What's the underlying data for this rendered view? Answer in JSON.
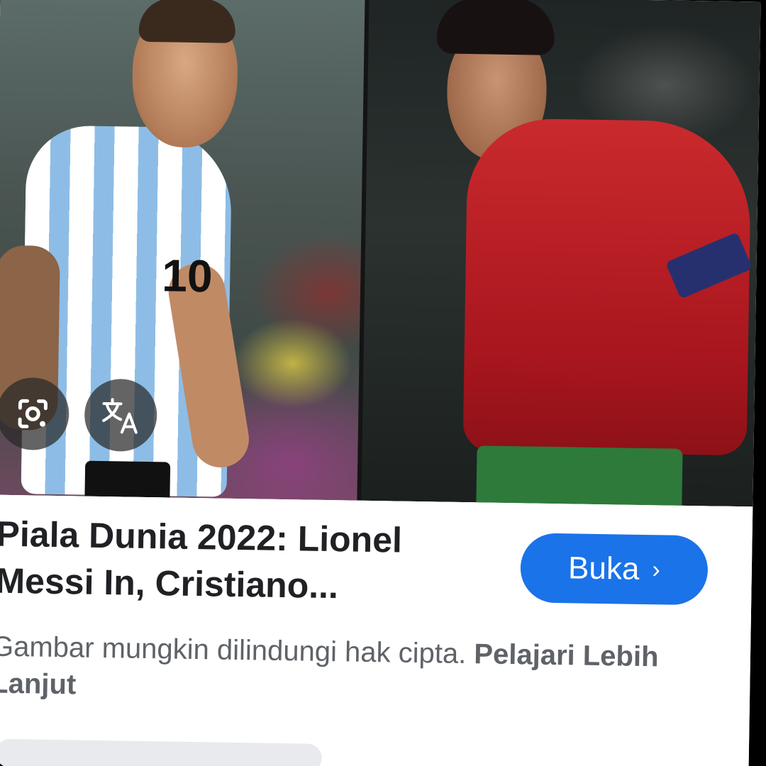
{
  "result": {
    "title": "Piala Dunia 2022: Lionel Messi In, Cristiano...",
    "open_button_label": "Buka",
    "open_button_chevron": "›",
    "copyright_notice": "Gambar mungkin dilindungi hak cipta.",
    "learn_more_link": "Pelajari Lebih Lanjut"
  },
  "image": {
    "left_player_shirt_number": "10"
  },
  "icons": {
    "lens": "google-lens-icon",
    "translate": "translate-icon"
  },
  "colors": {
    "accent": "#1a73e8",
    "title_text": "#202124",
    "secondary_text": "#5f6368"
  }
}
